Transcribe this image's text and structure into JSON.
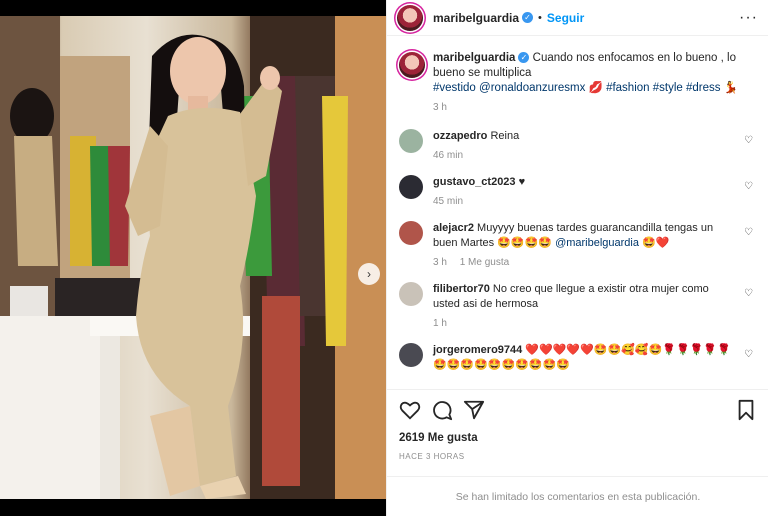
{
  "post": {
    "username": "maribelguardia",
    "follow_label": "Seguir",
    "separator": "•",
    "more_label": "···"
  },
  "caption": {
    "username": "maribelguardia",
    "text": "Cuando nos enfocamos en lo bueno , lo bueno se multiplica",
    "tag_vestido": "#vestido",
    "mention": "@ronaldoanzuresmx",
    "emoji_lips": "💋",
    "tag_fashion": "#fashion",
    "tag_style": "#style",
    "tag_dress": "#dress",
    "emoji_dancer": "💃",
    "time": "3 h"
  },
  "comments": [
    {
      "username": "ozzapedro",
      "text": "Reina",
      "time": "46 min",
      "likes": "",
      "avatar_color": "#9bb3a0"
    },
    {
      "username": "gustavo_ct2023",
      "text": "♥",
      "time": "45 min",
      "likes": "",
      "avatar_color": "#2b2b33"
    },
    {
      "username": "alejacr2",
      "text": "Muyyyy buenas tardes guarancandilla tengas un buen Martes 🤩🤩🤩🤩",
      "mention": "@maribelguardia",
      "tail": "🤩❤️",
      "time": "3 h",
      "likes": "1 Me gusta",
      "avatar_color": "#b0554a"
    },
    {
      "username": "filibertor70",
      "text": "No creo que llegue a existir otra mujer como usted asi de hermosa",
      "time": "1 h",
      "likes": "",
      "avatar_color": "#c9c2b8"
    },
    {
      "username": "jorgeromero9744",
      "text": "❤️❤️❤️❤️❤️🤩🤩🥰🥰🤩🌹🌹🌹🌹🌹",
      "line2": "🤩🤩🤩🤩🤩🤩🤩🤩🤩🤩",
      "time": "",
      "likes": "",
      "avatar_color": "#4a4a52"
    }
  ],
  "actions": {
    "likes_text": "2619 Me gusta",
    "date_text": "HACE 3 HORAS"
  },
  "footer": {
    "limited_text": "Se han limitado los comentarios en esta publicación."
  },
  "media": {
    "next_glyph": "›",
    "dress_color": "#d8c29a",
    "accent_color": "#3897f0"
  }
}
